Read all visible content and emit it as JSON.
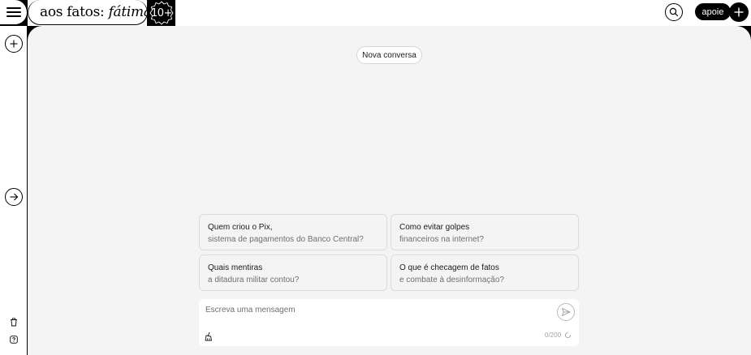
{
  "header": {
    "logo_main": "aos fatos:",
    "logo_italic": "fátima",
    "badge": "10+",
    "apoie_label": "apoie"
  },
  "main": {
    "new_conversation_label": "Nova conversa",
    "suggestions": [
      {
        "title": "Quem criou o Pix,",
        "subtitle": "sistema de pagamentos do Banco Central?"
      },
      {
        "title": "Como evitar golpes",
        "subtitle": "financeiros na internet?"
      },
      {
        "title": "Quais mentiras",
        "subtitle": "a ditadura militar contou?"
      },
      {
        "title": "O que é checagem de fatos",
        "subtitle": "e combate à desinformação?"
      }
    ],
    "composer": {
      "placeholder": "Escreva uma mensagem",
      "value": "",
      "counter": "0/200"
    }
  },
  "icons": {
    "menu": "hamburger-icon",
    "search": "search-icon",
    "plus": "plus-icon",
    "new_chat": "plus-circle-icon",
    "expand": "arrow-right-icon",
    "trash": "trash-icon",
    "help": "help-icon",
    "send": "send-icon",
    "clear": "broom-icon",
    "loading": "spinner-icon"
  },
  "colors": {
    "background": "#f4f4f4",
    "accent": "#000000",
    "text": "#1a1a1a",
    "muted": "#6f6f6f"
  }
}
